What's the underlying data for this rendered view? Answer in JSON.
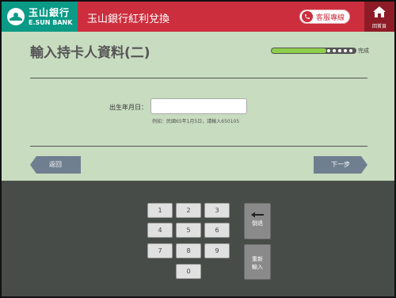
{
  "header": {
    "logo_cn": "玉山銀行",
    "logo_en": "E.SUN BANK",
    "title": "玉山銀行紅利兌換",
    "service_label": "客服專線",
    "home_label": "回首頁"
  },
  "page": {
    "title": "輸入持卡人資料(二)",
    "progress_label": "完成",
    "progress_fraction": 0.65
  },
  "form": {
    "birthdate_label": "出生年月日：",
    "birthdate_value": "",
    "birthdate_hint": "例如：民國65年1月5日，請輸入650105"
  },
  "nav": {
    "back_label": "返回",
    "next_label": "下一步"
  },
  "keypad": {
    "keys": [
      "1",
      "2",
      "3",
      "4",
      "5",
      "6",
      "7",
      "8",
      "9",
      "0"
    ],
    "backspace_label": "倒退",
    "reset_label_1": "重新",
    "reset_label_2": "輸入"
  },
  "colors": {
    "brand_red": "#cc2e3e",
    "brand_teal": "#0a9a86",
    "page_bg": "#c8dcc0",
    "keypad_bg": "#484c48",
    "progress_green": "#8dcf4a"
  }
}
